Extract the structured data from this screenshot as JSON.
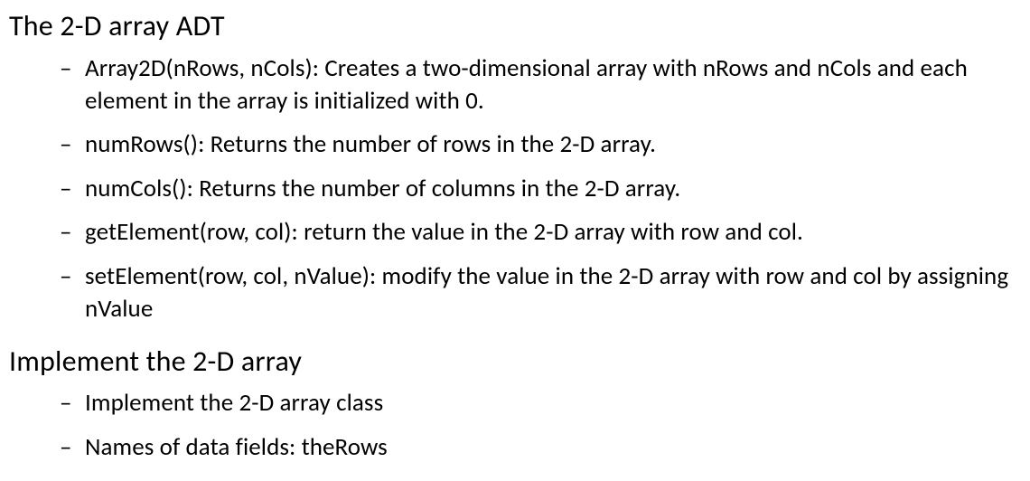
{
  "section1": {
    "heading": "The 2-D array ADT",
    "items": [
      "Array2D(nRows, nCols): Creates a two-dimensional array with nRows and nCols and each element in the array is initialized  with 0.",
      "numRows(): Returns the number of rows in the 2-D array.",
      "numCols(): Returns the number of columns in the 2-D array.",
      "getElement(row, col): return the value in the 2-D array with row and col.",
      "setElement(row, col, nValue): modify the value in the 2-D array with row and col by assigning nValue"
    ]
  },
  "section2": {
    "heading": "Implement the 2-D array",
    "items": [
      "Implement the 2-D array class",
      "Names of data fields: theRows"
    ]
  }
}
